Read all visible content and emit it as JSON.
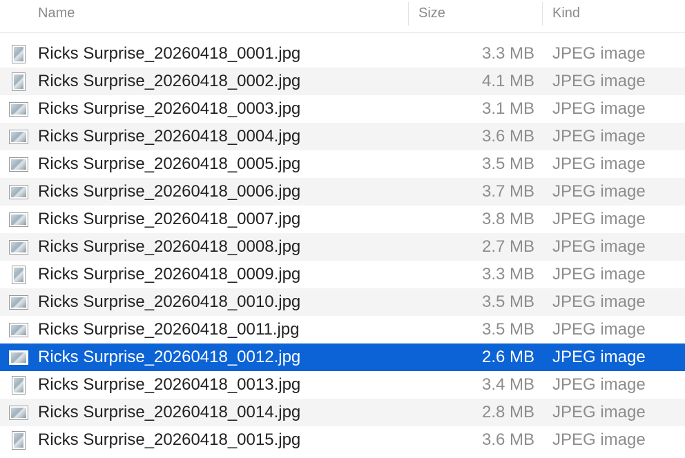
{
  "columns": {
    "name": "Name",
    "size": "Size",
    "kind": "Kind"
  },
  "files": [
    {
      "name": "Ricks Surprise_20260418_0001.jpg",
      "size": "3.3 MB",
      "kind": "JPEG image",
      "thumbnail": "portrait",
      "selected": false
    },
    {
      "name": "Ricks Surprise_20260418_0002.jpg",
      "size": "4.1 MB",
      "kind": "JPEG image",
      "thumbnail": "portrait",
      "selected": false
    },
    {
      "name": "Ricks Surprise_20260418_0003.jpg",
      "size": "3.1 MB",
      "kind": "JPEG image",
      "thumbnail": "landscape",
      "selected": false
    },
    {
      "name": "Ricks Surprise_20260418_0004.jpg",
      "size": "3.6 MB",
      "kind": "JPEG image",
      "thumbnail": "landscape",
      "selected": false
    },
    {
      "name": "Ricks Surprise_20260418_0005.jpg",
      "size": "3.5 MB",
      "kind": "JPEG image",
      "thumbnail": "landscape",
      "selected": false
    },
    {
      "name": "Ricks Surprise_20260418_0006.jpg",
      "size": "3.7 MB",
      "kind": "JPEG image",
      "thumbnail": "landscape",
      "selected": false
    },
    {
      "name": "Ricks Surprise_20260418_0007.jpg",
      "size": "3.8 MB",
      "kind": "JPEG image",
      "thumbnail": "landscape",
      "selected": false
    },
    {
      "name": "Ricks Surprise_20260418_0008.jpg",
      "size": "2.7 MB",
      "kind": "JPEG image",
      "thumbnail": "landscape",
      "selected": false
    },
    {
      "name": "Ricks Surprise_20260418_0009.jpg",
      "size": "3.3 MB",
      "kind": "JPEG image",
      "thumbnail": "portrait",
      "selected": false
    },
    {
      "name": "Ricks Surprise_20260418_0010.jpg",
      "size": "3.5 MB",
      "kind": "JPEG image",
      "thumbnail": "landscape",
      "selected": false
    },
    {
      "name": "Ricks Surprise_20260418_0011.jpg",
      "size": "3.5 MB",
      "kind": "JPEG image",
      "thumbnail": "landscape",
      "selected": false
    },
    {
      "name": "Ricks Surprise_20260418_0012.jpg",
      "size": "2.6 MB",
      "kind": "JPEG image",
      "thumbnail": "landscape",
      "selected": true
    },
    {
      "name": "Ricks Surprise_20260418_0013.jpg",
      "size": "3.4 MB",
      "kind": "JPEG image",
      "thumbnail": "portrait",
      "selected": false
    },
    {
      "name": "Ricks Surprise_20260418_0014.jpg",
      "size": "2.8 MB",
      "kind": "JPEG image",
      "thumbnail": "landscape",
      "selected": false
    },
    {
      "name": "Ricks Surprise_20260418_0015.jpg",
      "size": "3.6 MB",
      "kind": "JPEG image",
      "thumbnail": "portrait",
      "selected": false
    }
  ],
  "colors": {
    "selection": "#0b63d6",
    "alternate_row": "#f4f4f5",
    "secondary_text": "#8d8d8d"
  }
}
